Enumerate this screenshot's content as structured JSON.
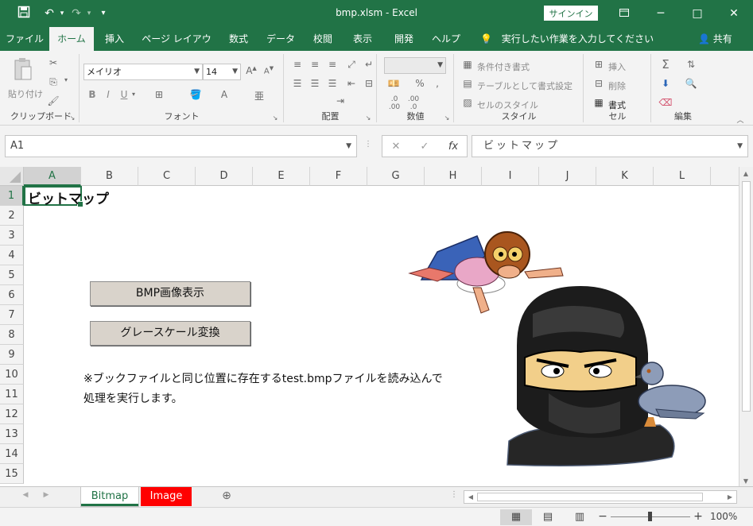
{
  "window": {
    "title": "bmp.xlsm  -  Excel",
    "signin_label": "サインイン",
    "minimize_glyph": "─",
    "maximize_glyph": "□",
    "close_glyph": "✕"
  },
  "quick_access": {
    "save_icon": "save-icon",
    "undo_icon": "undo-icon",
    "redo_icon": "redo-icon",
    "customize_icon": "customize-icon"
  },
  "tabs": [
    {
      "label": "ファイル"
    },
    {
      "label": "ホーム",
      "active": true
    },
    {
      "label": "挿入"
    },
    {
      "label": "ページ レイアウト"
    },
    {
      "label": "数式"
    },
    {
      "label": "データ"
    },
    {
      "label": "校閲"
    },
    {
      "label": "表示"
    },
    {
      "label": "開発"
    },
    {
      "label": "ヘルプ"
    }
  ],
  "tell_me": "実行したい作業を入力してください",
  "share_label": "共有",
  "ribbon": {
    "clipboard": {
      "label": "クリップボード",
      "paste_label": "貼り付け"
    },
    "font": {
      "label": "フォント",
      "font_name": "メイリオ",
      "font_size": "14"
    },
    "alignment": {
      "label": "配置"
    },
    "number": {
      "label": "数値",
      "format_value": ""
    },
    "styles": {
      "label": "スタイル",
      "conditional": "条件付き書式",
      "table": "テーブルとして書式設定",
      "cell_styles": "セルのスタイル"
    },
    "cells": {
      "label": "セル",
      "insert": "挿入",
      "delete": "削除",
      "format": "書式"
    },
    "editing": {
      "label": "編集"
    }
  },
  "formula_bar": {
    "name_box": "A1",
    "formula": "ビットマップ",
    "cancel_glyph": "✕",
    "enter_glyph": "✓",
    "fx_label": "fx"
  },
  "grid": {
    "columns": [
      "A",
      "B",
      "C",
      "D",
      "E",
      "F",
      "G",
      "H",
      "I",
      "J",
      "K",
      "L"
    ],
    "rows": [
      "1",
      "2",
      "3",
      "4",
      "5",
      "6",
      "7",
      "8",
      "9",
      "10",
      "11",
      "12",
      "13",
      "14",
      "15"
    ],
    "selected_cell": "A1"
  },
  "sheet": {
    "title_cell": "ビットマップ",
    "button_show": "BMP画像表示",
    "button_gray": "グレースケール変換",
    "note_line1": "※ブックファイルと同じ位置に存在するtest.bmpファイルを読み込んで",
    "note_line2": "処理を実行します。"
  },
  "sheet_tabs": [
    {
      "label": "Bitmap",
      "active": true
    },
    {
      "label": "Image",
      "color": "#ff0000"
    }
  ],
  "status": {
    "zoom": "100%"
  },
  "colors": {
    "excel_green": "#217346",
    "button_face": "#d9d3cb",
    "tab_red": "#ff0000"
  }
}
